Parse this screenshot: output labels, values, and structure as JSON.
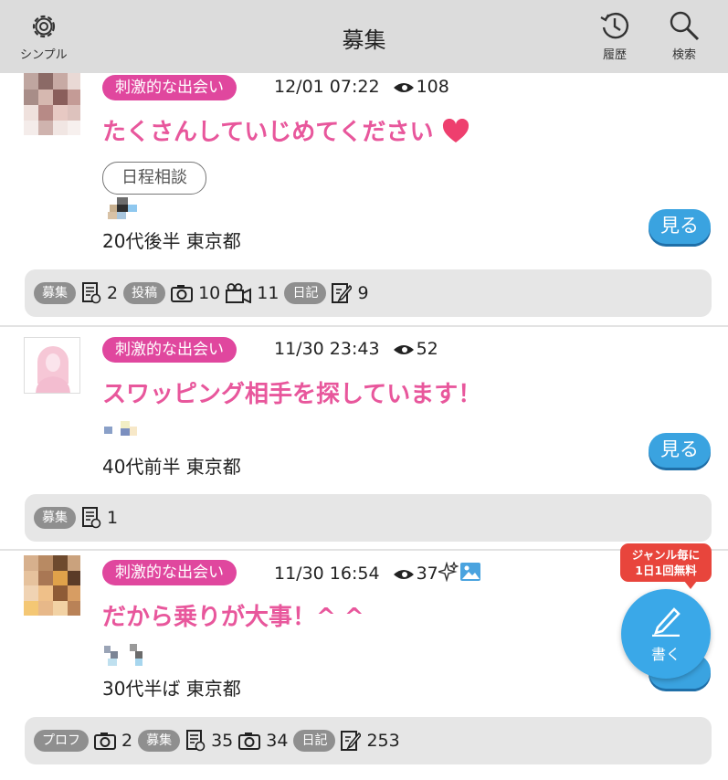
{
  "header": {
    "title": "募集",
    "left_label": "シンプル",
    "history_label": "履歴",
    "search_label": "検索"
  },
  "posts": [
    {
      "category": "刺激的な出会い",
      "date": "12/01 07:22",
      "views": "108",
      "title": "たくさんしていじめてください",
      "tag": "日程相談",
      "profile": "20代後半 東京都",
      "see_label": "見る",
      "stats": {
        "recruit_label": "募集",
        "recruit_count": "2",
        "post_label": "投稿",
        "photo_count": "10",
        "video_count": "11",
        "diary_label": "日記",
        "diary_count": "9"
      }
    },
    {
      "category": "刺激的な出会い",
      "date": "11/30 23:43",
      "views": "52",
      "title": "スワッピング相手を探しています！",
      "profile": "40代前半 東京都",
      "see_label": "見る",
      "stats": {
        "recruit_label": "募集",
        "recruit_count": "1"
      }
    },
    {
      "category": "刺激的な出会い",
      "date": "11/30 16:54",
      "views": "37",
      "title": "だから乗りが大事！^ ^",
      "profile": "30代半ば 東京都",
      "stats": {
        "profile_label": "プロフ",
        "profile_photo_count": "2",
        "recruit_label": "募集",
        "recruit_count": "35",
        "photo_count": "34",
        "diary_label": "日記",
        "diary_count": "253"
      }
    }
  ],
  "fab": {
    "label": "書く",
    "badge_line1": "ジャンル毎に",
    "badge_line2": "1日1回無料"
  },
  "colors": {
    "header_bg": "#dcdcdc",
    "category_pink": "#e0479e",
    "title_pink": "#e8579c",
    "button_blue": "#3aa3e0",
    "badge_red": "#e8453c"
  }
}
